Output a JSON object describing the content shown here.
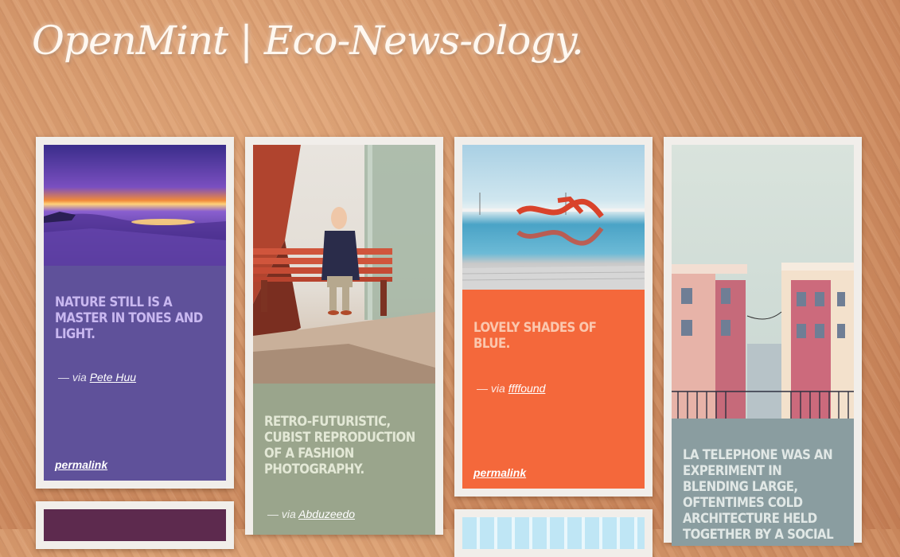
{
  "site": {
    "title": "OpenMint | Eco-News-ology."
  },
  "posts": [
    {
      "headline": "Nature still is a master in tones and light.",
      "via_prefix": "— via",
      "via_name": "Pete Huu",
      "permalink": "permalink",
      "image": "sunset-shore-photo",
      "accent": "#5f519a"
    },
    {
      "headline": "Retro-futuristic, cubist reproduction of a fashion photography.",
      "via_prefix": "— via",
      "via_name": "Abduzeedo",
      "image": "man-on-bench-illustration",
      "accent": "#9aa58c"
    },
    {
      "headline": "Lovely shades of blue.",
      "via_prefix": "— via",
      "via_name": "ffffound",
      "permalink": "permalink",
      "image": "water-slide-pool-photo",
      "accent": "#f4683b"
    },
    {
      "headline": "La Telephone was an experiment in blending large, oftentimes cold architecture held together by a social",
      "image": "townhouses-illustration",
      "accent": "#8a9da0"
    }
  ]
}
